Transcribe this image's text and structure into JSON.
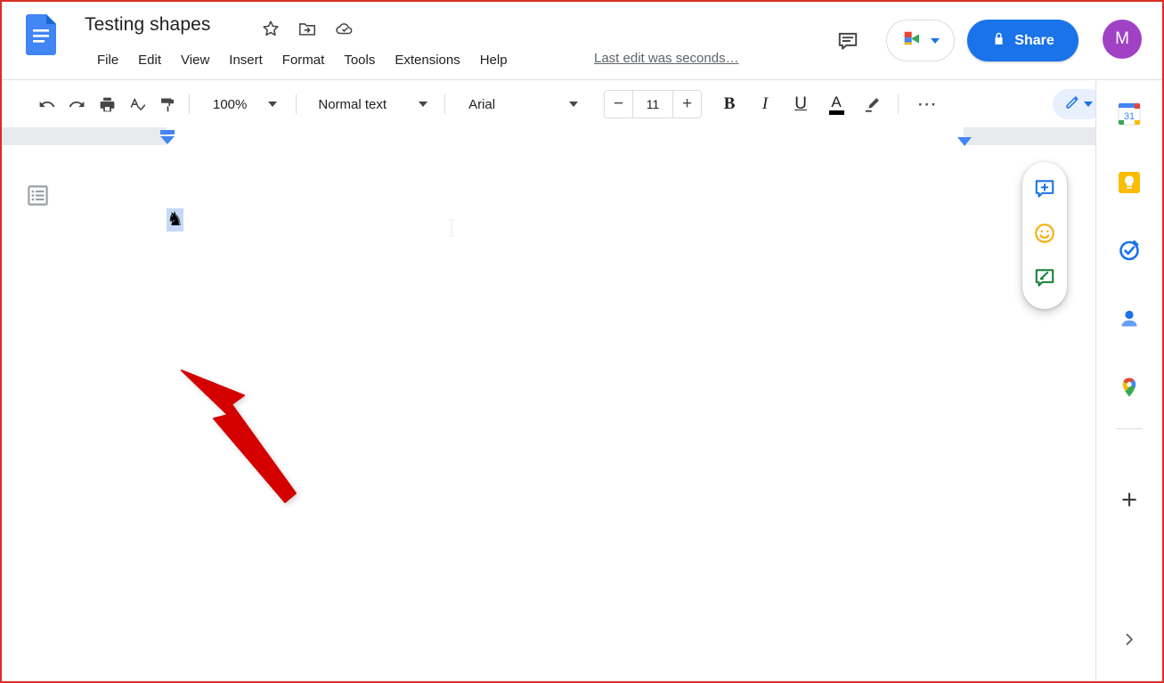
{
  "app": {
    "name": "Google Docs",
    "logo_icon": "docs-logo-icon"
  },
  "header": {
    "doc_title": "Testing shapes",
    "title_icons": [
      {
        "name": "star-icon",
        "label": "Star"
      },
      {
        "name": "move-to-folder-icon",
        "label": "Move"
      },
      {
        "name": "cloud-saved-icon",
        "label": "Saved to Drive"
      }
    ],
    "menus": [
      "File",
      "Edit",
      "View",
      "Insert",
      "Format",
      "Tools",
      "Extensions",
      "Help"
    ],
    "last_edit": "Last edit was seconds…",
    "comment_icon": "comment-history-icon",
    "meet_icon": "google-meet-icon",
    "share_label": "Share",
    "share_lock_icon": "lock-icon",
    "avatar_initial": "M",
    "avatar_color": "#a142c4",
    "share_color": "#1a73e8"
  },
  "toolbar": {
    "undo_icon": "undo-icon",
    "redo_icon": "redo-icon",
    "print_icon": "print-icon",
    "spellcheck_icon": "spellcheck-icon",
    "paint_format_icon": "paint-format-icon",
    "zoom_level": "100%",
    "paragraph_style": "Normal text",
    "font_family": "Arial",
    "font_size": "11",
    "decrease_label": "−",
    "increase_label": "+",
    "bold_label": "B",
    "italic_label": "I",
    "underline_label": "U",
    "text_color_label": "A",
    "text_color_swatch": "#000000",
    "highlight_icon": "highlight-pen-icon",
    "more_label": "⋯",
    "edit_mode_icon": "pencil-edit-icon",
    "edit_mode_color": "#1a73e8",
    "collapse_icon": "chevron-up-icon"
  },
  "ruler": {
    "left_indent_marker": "left-indent-marker",
    "right_indent_marker": "right-indent-marker"
  },
  "document": {
    "outline_icon": "show-outline-icon",
    "content_glyph": "♞",
    "glyph_name": "chess-knight-glyph",
    "glyph_selected": true,
    "selection_color": "#c5d9f7",
    "text_cursor_icon": "text-cursor-icon",
    "annotation_arrow": {
      "name": "red-annotation-arrow",
      "color": "#d40000"
    }
  },
  "floating_actions": [
    {
      "name": "add-comment-button",
      "icon": "add-comment-icon",
      "color": "#1a73e8"
    },
    {
      "name": "add-emoji-reaction-button",
      "icon": "emoji-smiley-icon",
      "color": "#f9ab00"
    },
    {
      "name": "suggest-edit-button",
      "icon": "suggest-edit-icon",
      "color": "#188038"
    }
  ],
  "sidebar": {
    "items": [
      {
        "name": "sidebar-item-calendar",
        "icon": "google-calendar-icon",
        "label": "Calendar",
        "badge": "31"
      },
      {
        "name": "sidebar-item-keep",
        "icon": "google-keep-icon",
        "label": "Keep"
      },
      {
        "name": "sidebar-item-tasks",
        "icon": "google-tasks-icon",
        "label": "Tasks"
      },
      {
        "name": "sidebar-item-contacts",
        "icon": "google-contacts-icon",
        "label": "Contacts"
      },
      {
        "name": "sidebar-item-maps",
        "icon": "google-maps-icon",
        "label": "Maps"
      }
    ],
    "add_label": "+",
    "expand_icon": "chevron-right-icon"
  }
}
